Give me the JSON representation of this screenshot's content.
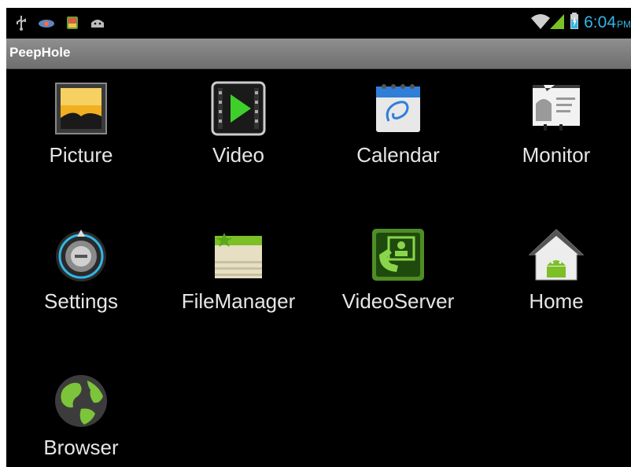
{
  "status_bar": {
    "time": "6:04",
    "ampm": "PM",
    "notification_icons": [
      "usb-icon",
      "eye-icon",
      "image-notification-icon",
      "android-notification-icon"
    ],
    "system_icons": [
      "wifi-icon",
      "signal-icon",
      "battery-icon"
    ],
    "accent_color": "#33b5e5"
  },
  "title_bar": {
    "title": "PeepHole"
  },
  "apps": [
    {
      "label": "Picture",
      "icon": "picture-icon"
    },
    {
      "label": "Video",
      "icon": "video-icon"
    },
    {
      "label": "Calendar",
      "icon": "calendar-icon"
    },
    {
      "label": "Monitor",
      "icon": "monitor-icon"
    },
    {
      "label": "Settings",
      "icon": "settings-icon"
    },
    {
      "label": "FileManager",
      "icon": "file-manager-icon"
    },
    {
      "label": "VideoServer",
      "icon": "video-server-icon"
    },
    {
      "label": "Home",
      "icon": "home-icon"
    },
    {
      "label": "Browser",
      "icon": "browser-icon"
    }
  ]
}
